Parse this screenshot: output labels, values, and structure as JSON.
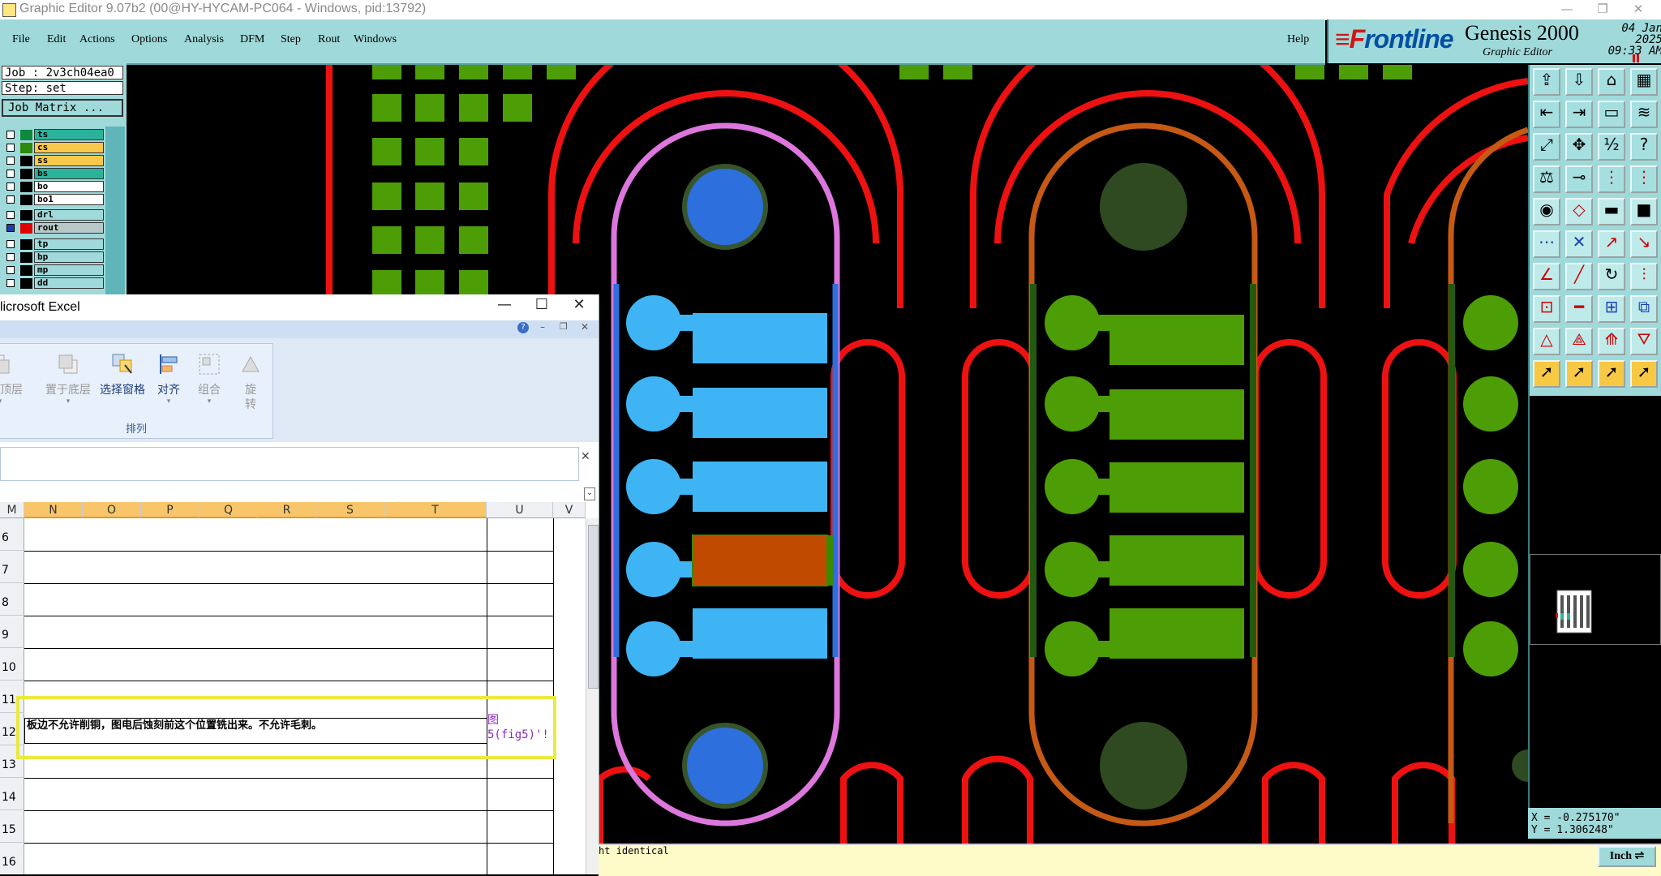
{
  "window": {
    "title": "Graphic Editor 9.07b2 (00@HY-HYCAM-PC064 - Windows, pid:13792)",
    "min": "—",
    "restore": "❐",
    "close": "✕"
  },
  "menu": [
    "File",
    "Edit",
    "Actions",
    "Options",
    "Analysis",
    "DFM",
    "Step",
    "Rout",
    "Windows"
  ],
  "help_label": "Help",
  "brand": {
    "logo_mark": "≡F",
    "logo_text": "rontline",
    "product": "Genesis 2000",
    "subtitle": "Graphic Editor",
    "date": "04 Jan 2025",
    "time": "09:33 AM"
  },
  "job": {
    "job_line": "Job : 2v3ch04ea0",
    "step_line": "Step: set",
    "matrix_button": "Job Matrix ..."
  },
  "layers": [
    {
      "name": "ts",
      "color": "#0e8a3e",
      "bg": "#2bb39a"
    },
    {
      "name": "cs",
      "color": "#000000",
      "bg": "#f8c84a"
    },
    {
      "name": "ss",
      "color": "#000000",
      "bg": "#f8c84a"
    },
    {
      "name": "bs",
      "color": "#000000",
      "bg": "#2bb39a"
    },
    {
      "name": "bo",
      "color": "#000000",
      "bg": "#ffffff"
    },
    {
      "name": "bo1",
      "color": "#000000",
      "bg": "#ffffff"
    },
    {
      "name": "drl",
      "color": "#000000",
      "bg": "#9fd9da"
    },
    {
      "name": "rout",
      "color": "#e00000",
      "bg": "#b8c8c8"
    },
    {
      "name": "tp",
      "color": "#000000",
      "bg": "#9fd9da"
    },
    {
      "name": "bp",
      "color": "#000000",
      "bg": "#9fd9da"
    },
    {
      "name": "mp",
      "color": "#000000",
      "bg": "#9fd9da"
    },
    {
      "name": "dd",
      "color": "#000000",
      "bg": "#9fd9da"
    }
  ],
  "excel": {
    "title": "licrosoft Excel",
    "ribbon_buttons": [
      "置于顶层",
      "置于底层",
      "选择窗格",
      "对齐",
      "组合",
      "旋转"
    ],
    "ribbon_group": "排列",
    "columns": [
      "M",
      "N",
      "O",
      "P",
      "Q",
      "R",
      "S",
      "T",
      "U",
      "V"
    ],
    "rows": [
      "6",
      "7",
      "8",
      "9",
      "10",
      "11",
      "12",
      "13",
      "14",
      "15",
      "16"
    ],
    "cell_text": "板边不允许削铜，图电后蚀刻前这个位置铣出来。不允许毛刺。",
    "cell_link": "图 5(fig5)'!"
  },
  "coordinates": {
    "x": "X = -0.275170\"",
    "y": "Y =  1.306248\""
  },
  "status": {
    "message": "ht identical",
    "unit": "Inch"
  },
  "colors": {
    "rout": "#ee1111",
    "copper_blue": "#3fb4f4",
    "copper_green": "#4d9d07",
    "hole_blue": "#2d6fdc",
    "selected_pad": "#c04a00",
    "outline_magenta": "#dd77dd"
  }
}
